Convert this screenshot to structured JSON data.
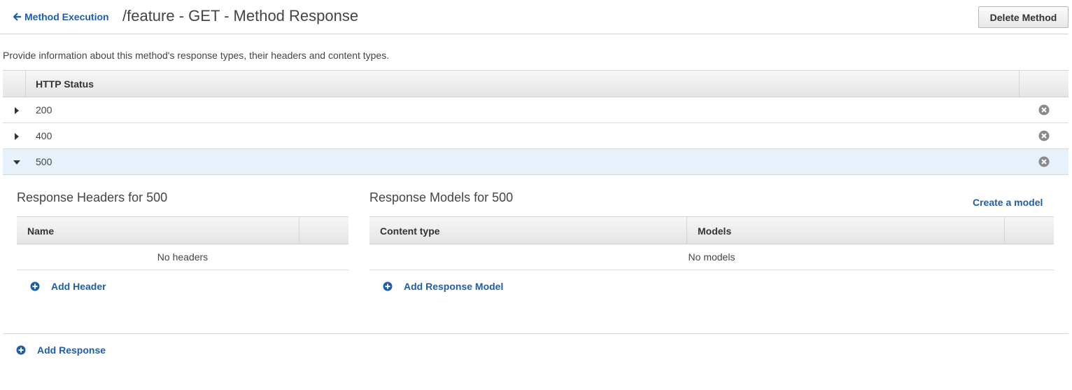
{
  "header": {
    "back_label": "Method Execution",
    "title": "/feature - GET - Method Response",
    "delete_label": "Delete Method"
  },
  "description": "Provide information about this method's response types, their headers and content types.",
  "status_table": {
    "column_header": "HTTP Status",
    "rows": [
      {
        "code": "200",
        "expanded": false
      },
      {
        "code": "400",
        "expanded": false
      },
      {
        "code": "500",
        "expanded": true
      }
    ]
  },
  "headers_section": {
    "title": "Response Headers for 500",
    "column_name": "Name",
    "empty_text": "No headers",
    "add_label": "Add Header"
  },
  "models_section": {
    "title": "Response Models for 500",
    "create_link": "Create a model",
    "column_content_type": "Content type",
    "column_models": "Models",
    "empty_text": "No models",
    "add_label": "Add Response Model"
  },
  "add_response_label": "Add Response",
  "colors": {
    "link": "#1f5da8",
    "expanded_row": "#e6f1fb",
    "icon_gray": "#8a8a8a"
  },
  "icons": {
    "back": "arrow-left-icon",
    "collapsed": "caret-right-icon",
    "expanded": "caret-down-icon",
    "remove": "close-circle-icon",
    "add": "plus-circle-icon"
  }
}
